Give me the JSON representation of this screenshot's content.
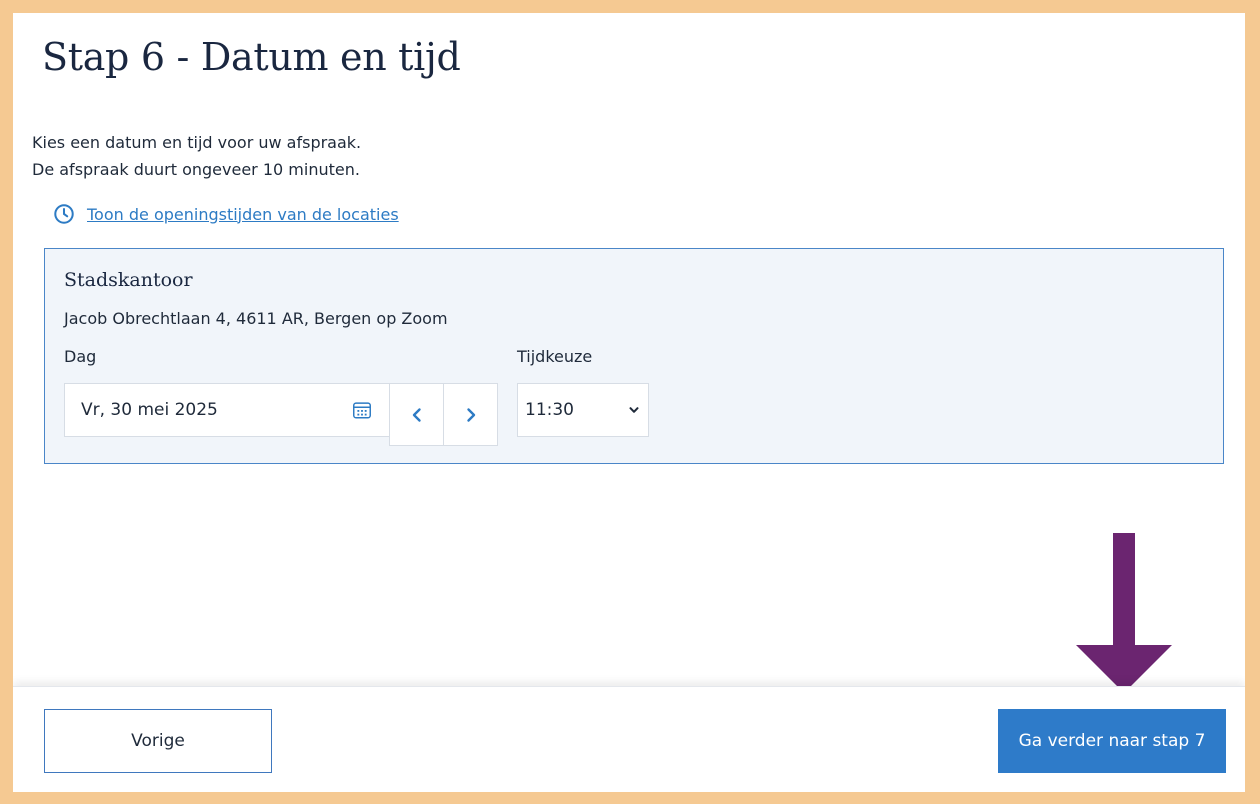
{
  "step": {
    "title": "Stap 6 - Datum en tijd",
    "intro_line1": "Kies een datum en tijd voor uw afspraak.",
    "intro_line2": "De afspraak duurt ongeveer 10 minuten."
  },
  "opening_hours_link": {
    "label": "Toon de openingstijden van de locaties",
    "icon": "clock-icon"
  },
  "location": {
    "name": "Stadskantoor",
    "address": "Jacob Obrechtlaan 4, 4611 AR, Bergen op Zoom",
    "day_label": "Dag",
    "day_value": "Vr, 30 mei 2025",
    "time_label": "Tijdkeuze",
    "time_value": "11:30",
    "calendar_icon": "calendar-icon",
    "prev_icon": "chevron-left-icon",
    "next_icon": "chevron-right-icon",
    "select_icon": "chevron-down-icon"
  },
  "footer": {
    "prev_label": "Vorige",
    "next_label": "Ga verder naar stap 7"
  },
  "annotation": {
    "arrow_icon": "arrow-down-icon"
  },
  "colors": {
    "frame": "#f5c992",
    "primary": "#2e7bc9",
    "link": "#2d7bc4",
    "arrow": "#6b2570",
    "box_bg": "#f1f5fa"
  }
}
